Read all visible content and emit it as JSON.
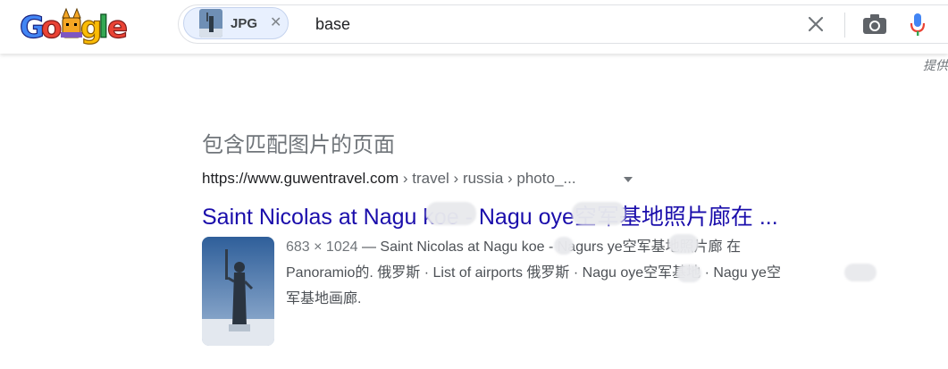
{
  "header": {
    "logo_label": "Google",
    "search": {
      "chip_label": "JPG",
      "query": "base"
    },
    "provider_text": "提供"
  },
  "results": {
    "section_title": "包含匹配图片的页面",
    "item": {
      "url_domain": "https://www.guwentravel.com",
      "url_path": " › travel › russia › photo_...",
      "title": "Saint Nicolas at Nagu   koe - Nagu   oye空军基地照片廊在 ...",
      "snippet_meta": "683 × 1024",
      "snippet_line1": " — Saint Nicolas at Nagu   koe - Nagurs   ye空军基地照片廊 在",
      "snippet_line2": "Panoramio的. 俄罗斯 · List of airports 俄罗斯 · Nagu   oye空军基地 · Nagu   ye空",
      "snippet_line3": "军基地画廊."
    }
  },
  "colors": {
    "link": "#1a0dab",
    "chip_bg": "#e8f0fe",
    "mic_blue": "#4285f4",
    "mic_red": "#ea4335"
  }
}
